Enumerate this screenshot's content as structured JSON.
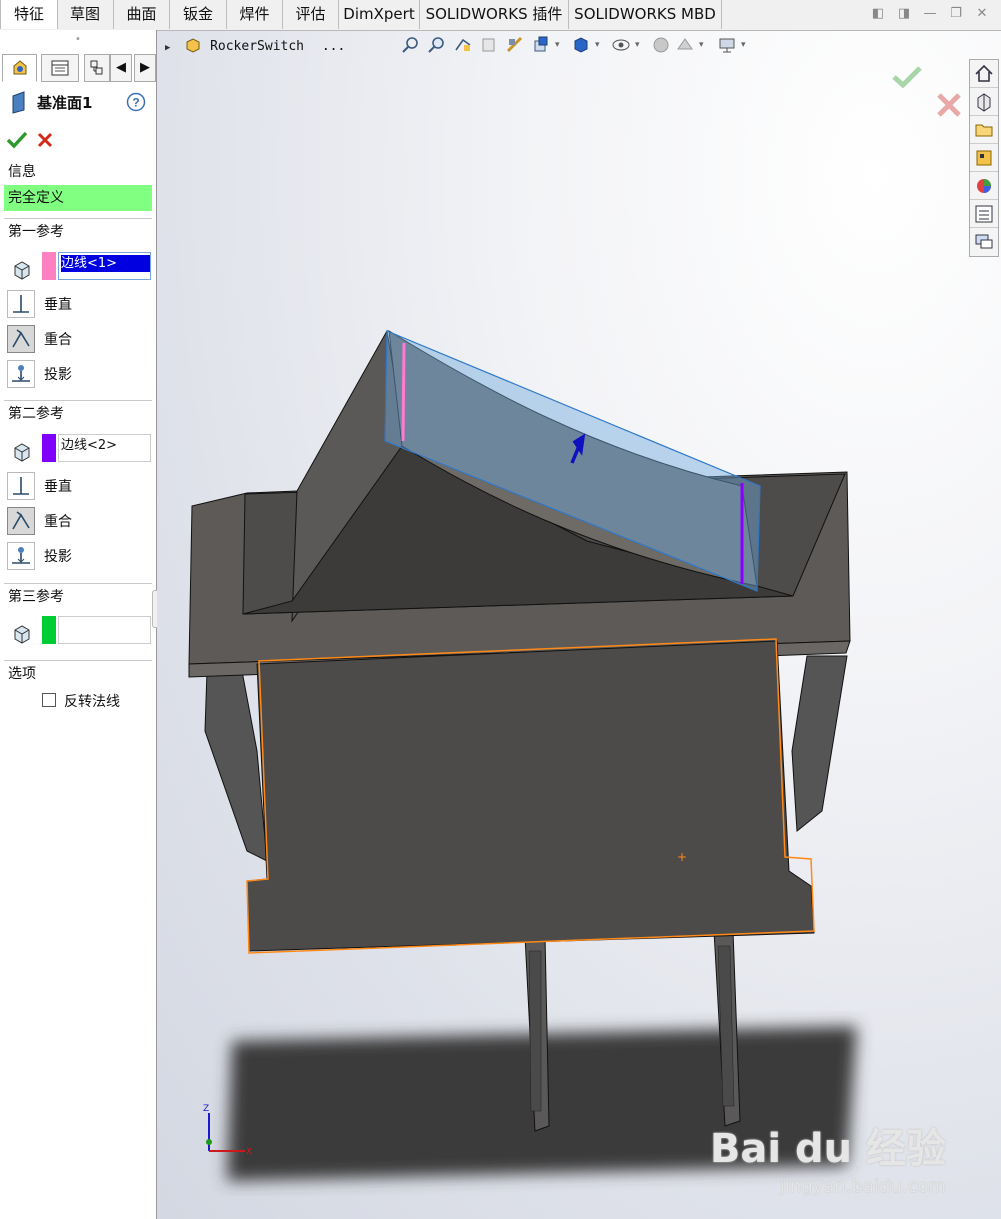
{
  "tabs": [
    {
      "label": "特征",
      "active": true
    },
    {
      "label": "草图",
      "active": false
    },
    {
      "label": "曲面",
      "active": false
    },
    {
      "label": "钣金",
      "active": false
    },
    {
      "label": "焊件",
      "active": false
    },
    {
      "label": "评估",
      "active": false
    },
    {
      "label": "DimXpert",
      "active": false
    },
    {
      "label": "SOLIDWORKS 插件",
      "active": false
    },
    {
      "label": "SOLIDWORKS MBD",
      "active": false
    }
  ],
  "property_manager": {
    "title": "基准面1",
    "info_header": "信息",
    "status": "完全定义",
    "status_color": "#80ff80",
    "first_ref": {
      "header": "第一参考",
      "selection": "边线<1>",
      "color": "#ff80c0",
      "options": [
        "垂直",
        "重合",
        "投影"
      ]
    },
    "second_ref": {
      "header": "第二参考",
      "selection": "边线<2>",
      "color": "#8000ff",
      "options": [
        "垂直",
        "重合",
        "投影"
      ]
    },
    "third_ref": {
      "header": "第三参考",
      "selection": "",
      "color": "#00cc33"
    },
    "options_header": "选项",
    "flip_normal_label": "反转法线",
    "flip_normal_checked": false
  },
  "graphics": {
    "tree_path": "RockerSwitch",
    "tree_ellipsis": "...",
    "accent_plane_color": "#6fa8dc",
    "watermark": "Bai du 经验",
    "watermark_url": "jingyan.baidu.com"
  }
}
